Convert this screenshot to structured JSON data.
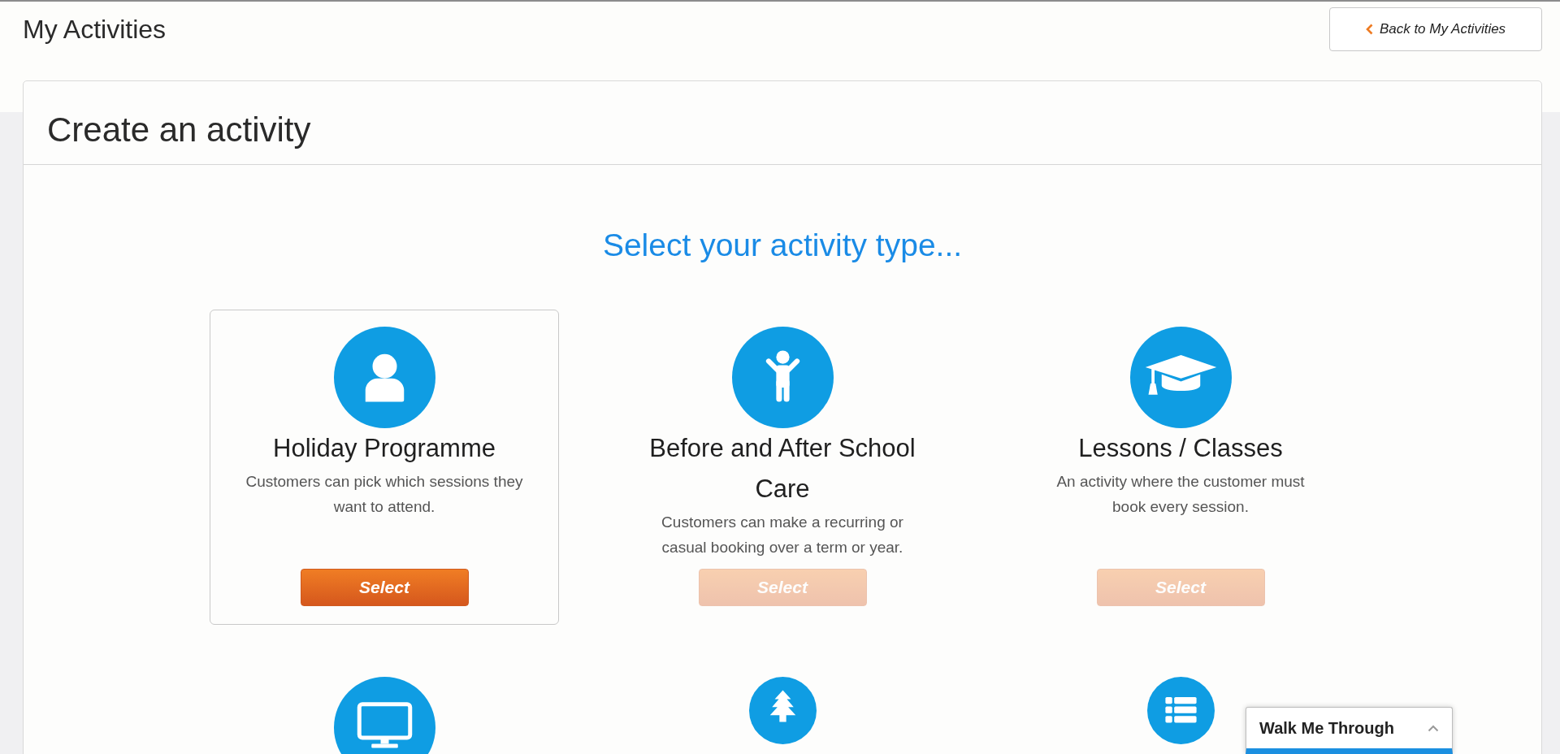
{
  "header": {
    "title": "My Activities",
    "back_button": {
      "label": "Back to My Activities"
    }
  },
  "panel": {
    "title": "Create an activity",
    "prompt": "Select your activity type...",
    "activity_types": [
      {
        "kind": "person",
        "title": "Holiday Programme",
        "description": "Customers can pick which sessions they want to attend.",
        "button": "Select",
        "highlighted": true
      },
      {
        "kind": "child",
        "title": "Before and After School Care",
        "description": "Customers can make a recurring or casual booking over a term or year.",
        "button": "Select",
        "highlighted": false
      },
      {
        "kind": "graduation-cap",
        "title": "Lessons / Classes",
        "description": "An activity where the customer must book every session.",
        "button": "Select",
        "highlighted": false
      },
      {
        "kind": "monitor"
      },
      {
        "kind": "tree"
      },
      {
        "kind": "list"
      }
    ]
  },
  "walk_me_through": {
    "label": "Walk Me Through",
    "expanded": false
  }
}
